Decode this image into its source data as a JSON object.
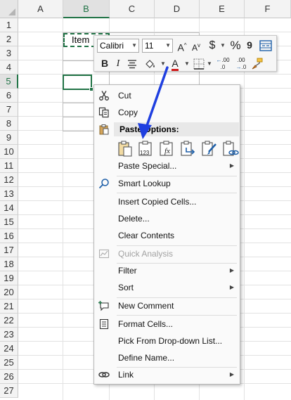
{
  "columns": [
    "A",
    "B",
    "C",
    "D",
    "E",
    "F"
  ],
  "rows": [
    "1",
    "2",
    "3",
    "4",
    "5",
    "6",
    "7",
    "8",
    "9",
    "10",
    "11",
    "12",
    "13",
    "14",
    "15",
    "16",
    "17",
    "18",
    "19",
    "20",
    "21",
    "22",
    "23",
    "24",
    "25",
    "26",
    "27"
  ],
  "cell_b2": "Item",
  "mini_toolbar": {
    "font_name": "Calibri",
    "font_size": "11",
    "increase_font": "A",
    "decrease_font": "A",
    "currency": "$",
    "percent": "%",
    "comma": "9",
    "bold": "B",
    "italic": "I",
    "font_color_letter": "A",
    "decimal_increase": ".00",
    "decimal_decrease": ".00",
    "accent_color": "#d11a1a",
    "arrow_color": "#1f3fe0"
  },
  "context_menu": {
    "cut": "Cut",
    "copy": "Copy",
    "paste_options": "Paste Options:",
    "paste_values_digits": "123",
    "paste_formulas_label": "fx",
    "paste_special": "Paste Special...",
    "smart_lookup": "Smart Lookup",
    "insert_copied_cells": "Insert Copied Cells...",
    "delete": "Delete...",
    "clear_contents": "Clear Contents",
    "quick_analysis": "Quick Analysis",
    "filter": "Filter",
    "sort": "Sort",
    "new_comment": "New Comment",
    "format_cells": "Format Cells...",
    "pick_from_dropdown": "Pick From Drop-down List...",
    "define_name": "Define Name...",
    "link": "Link"
  }
}
